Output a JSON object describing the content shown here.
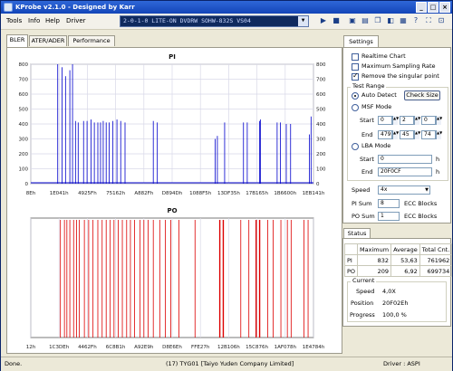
{
  "window": {
    "title": "KProbe v2.1.0 - Designed by Karr"
  },
  "menu": [
    "Tools",
    "Info",
    "Help",
    "Driver"
  ],
  "drive_select": "2-0-1-0 LITE-ON DVDRW SOHW-832S VS04",
  "tabs": [
    "BLER",
    "ATER/ADER",
    "Performance"
  ],
  "settings": {
    "tab_label": "Settings",
    "realtime_chart": "Realtime Chart",
    "maximum_sampling_rate": "Maximum Sampling Rate",
    "remove_singular_point": "Remove the singular point",
    "test_range_label": "Test Range",
    "auto_detect": "Auto Detect",
    "check_size_button": "Check Size",
    "msf_mode": "MSF Mode",
    "start_label": "Start",
    "end_label": "End",
    "msf_start": [
      "0",
      "2",
      "0"
    ],
    "msf_end": [
      "479",
      "45",
      "74"
    ],
    "lba_mode": "LBA Mode",
    "lba_start": "0",
    "lba_end": "20F0CF",
    "lba_unit": "h",
    "speed_label": "Speed",
    "speed_value": "4x",
    "pi_sum_label": "PI Sum",
    "pi_sum_value": "8",
    "po_sum_label": "PO Sum",
    "po_sum_value": "1",
    "ecc_blocks": "ECC Blocks"
  },
  "status": {
    "tab_label": "Status",
    "headers": [
      "",
      "Maximum",
      "Average",
      "Total Cnt."
    ],
    "rows": [
      [
        "PI",
        "832",
        "53,63",
        "761962"
      ],
      [
        "PO",
        "209",
        "6,92",
        "699734"
      ]
    ],
    "current_label": "Current",
    "speed_label": "Speed",
    "speed_value": "4,0X",
    "position_label": "Position",
    "position_value": "20F02Eh",
    "progress_label": "Progress",
    "progress_value": "100,0 %"
  },
  "statusbar": {
    "left": "Done.",
    "center": "(17) TYG01 [Taiyo Yuden Company Limited]",
    "right": "Driver : ASPI"
  },
  "chart_data": [
    {
      "type": "bar",
      "title": "PI",
      "ylim": [
        0,
        800
      ],
      "yticks": [
        0,
        100,
        200,
        300,
        400,
        500,
        600,
        700,
        800
      ],
      "xticks": [
        "8Eh",
        "1E041h",
        "4925Fh",
        "75162h",
        "A882Fh",
        "D894Dh",
        "1088F5h",
        "13DF35h",
        "17B165h",
        "1B6600h",
        "1EB141h"
      ],
      "color": "#0000cc",
      "x_max": 2100000,
      "x": [
        200000,
        232000,
        258000,
        290000,
        310000,
        332000,
        352000,
        392000,
        418000,
        448000,
        472000,
        498000,
        518000,
        538000,
        560000,
        582000,
        610000,
        640000,
        668000,
        700000,
        910000,
        940000,
        1370000,
        1386000,
        1440000,
        1580000,
        1608000,
        1700000,
        1706000,
        1830000,
        1854000,
        1898000,
        1930000,
        2070000,
        2082000
      ],
      "values": [
        800,
        780,
        720,
        760,
        800,
        420,
        410,
        420,
        420,
        430,
        410,
        410,
        410,
        420,
        410,
        410,
        420,
        430,
        420,
        410,
        420,
        410,
        300,
        320,
        410,
        410,
        410,
        420,
        430,
        410,
        410,
        400,
        400,
        330,
        450
      ]
    },
    {
      "type": "bar",
      "title": "PO",
      "xticks": [
        "12h",
        "1C3DEh",
        "4462Fh",
        "6C8B1h",
        "A92E9h",
        "D8E6Eh",
        "FFE27h",
        "12B106h",
        "15C876h",
        "1AF078h",
        "1E4784h"
      ],
      "color": "#dd0000",
      "x_max": 2100000,
      "x": [
        220000,
        250000,
        268000,
        290000,
        318000,
        340000,
        360000,
        398000,
        430000,
        462000,
        498000,
        530000,
        560000,
        590000,
        618000,
        650000,
        680000,
        712000,
        740000,
        770000,
        812000,
        840000,
        872000,
        910000,
        958000,
        1000000,
        1040000,
        1100000,
        1220000,
        1404000,
        1430000,
        1560000,
        1620000,
        1674000,
        1700000,
        1760000,
        1800000,
        1858000,
        1906000,
        1934000,
        2030000,
        2060000
      ],
      "values": [
        1,
        1,
        1,
        1,
        1,
        1,
        1,
        1,
        1,
        1,
        1,
        1,
        1,
        1,
        1,
        1,
        1,
        1,
        1,
        1,
        1,
        1,
        1,
        1,
        1,
        1,
        1,
        1,
        1,
        1,
        1,
        1,
        1,
        1,
        1,
        1,
        1,
        1,
        1,
        1,
        1,
        1
      ],
      "strong": [
        1404000,
        1430000,
        1674000,
        1700000
      ]
    }
  ]
}
